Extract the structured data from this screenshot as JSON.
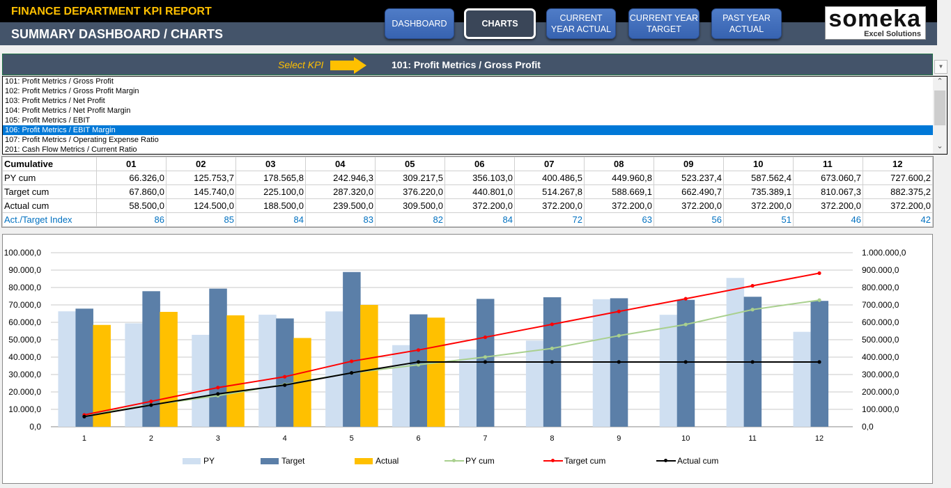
{
  "header": {
    "app_title": "FINANCE DEPARTMENT KPI REPORT",
    "page_title": "SUMMARY DASHBOARD / CHARTS",
    "nav": [
      {
        "label": "DASHBOARD",
        "active": false
      },
      {
        "label": "CHARTS",
        "active": true
      },
      {
        "label": "CURRENT YEAR ACTUAL",
        "active": false
      },
      {
        "label": "CURRENT YEAR TARGET",
        "active": false
      },
      {
        "label": "PAST YEAR ACTUAL",
        "active": false
      }
    ],
    "logo": {
      "brand": "someka",
      "sub": "Excel Solutions"
    }
  },
  "kpi_selector": {
    "label": "Select KPI",
    "value": "101: Profit Metrics / Gross Profit",
    "options": [
      "101: Profit Metrics / Gross Profit",
      "102: Profit Metrics / Gross Profit Margin",
      "103: Profit Metrics / Net Profit",
      "104: Profit Metrics / Net Profit Margin",
      "105: Profit Metrics / EBIT",
      "106: Profit Metrics / EBIT Margin",
      "107: Profit Metrics / Operating Expense Ratio",
      "201: Cash Flow Metrics / Current Ratio"
    ],
    "highlighted_index": 5
  },
  "table": {
    "header": "Cumulative",
    "months": [
      "01",
      "02",
      "03",
      "04",
      "05",
      "06",
      "07",
      "08",
      "09",
      "10",
      "11",
      "12"
    ],
    "rows": [
      {
        "label": "PY cum",
        "values": [
          "66.326,0",
          "125.753,7",
          "178.565,8",
          "242.946,3",
          "309.217,5",
          "356.103,0",
          "400.486,5",
          "449.960,8",
          "523.237,4",
          "587.562,4",
          "673.060,7",
          "727.600,2"
        ]
      },
      {
        "label": "Target cum",
        "values": [
          "67.860,0",
          "145.740,0",
          "225.100,0",
          "287.320,0",
          "376.220,0",
          "440.801,0",
          "514.267,8",
          "588.669,1",
          "662.490,7",
          "735.389,1",
          "810.067,3",
          "882.375,2"
        ]
      },
      {
        "label": "Actual cum",
        "values": [
          "58.500,0",
          "124.500,0",
          "188.500,0",
          "239.500,0",
          "309.500,0",
          "372.200,0",
          "372.200,0",
          "372.200,0",
          "372.200,0",
          "372.200,0",
          "372.200,0",
          "372.200,0"
        ]
      },
      {
        "label": "Act./Target Index",
        "values": [
          "86",
          "85",
          "84",
          "83",
          "82",
          "84",
          "72",
          "63",
          "56",
          "51",
          "46",
          "42"
        ]
      }
    ]
  },
  "chart_data": {
    "type": "bar",
    "categories": [
      "1",
      "2",
      "3",
      "4",
      "5",
      "6",
      "7",
      "8",
      "9",
      "10",
      "11",
      "12"
    ],
    "series": [
      {
        "name": "PY",
        "kind": "bar",
        "axis": "left",
        "color": "#cfdff1",
        "values": [
          66326.0,
          59427.7,
          52812.1,
          64380.5,
          66271.2,
          46885.5,
          44383.5,
          49474.3,
          73276.6,
          64325.0,
          85498.3,
          54539.5
        ]
      },
      {
        "name": "Target",
        "kind": "bar",
        "axis": "left",
        "color": "#5b7fa8",
        "values": [
          67860.0,
          77880.0,
          79360.0,
          62220.0,
          88900.0,
          64581.0,
          73466.8,
          74401.3,
          73821.6,
          72898.4,
          74678.2,
          72307.9
        ]
      },
      {
        "name": "Actual",
        "kind": "bar",
        "axis": "left",
        "color": "#ffc000",
        "values": [
          58500,
          66000,
          64000,
          51000,
          70000,
          62700,
          0,
          0,
          0,
          0,
          0,
          0
        ]
      },
      {
        "name": "PY cum",
        "kind": "line",
        "axis": "right",
        "color": "#a9d08e",
        "values": [
          66326.0,
          125753.7,
          178565.8,
          242946.3,
          309217.5,
          356103.0,
          400486.5,
          449960.8,
          523237.4,
          587562.4,
          673060.7,
          727600.2
        ]
      },
      {
        "name": "Target cum",
        "kind": "line",
        "axis": "right",
        "color": "#ff0000",
        "values": [
          67860.0,
          145740.0,
          225100.0,
          287320.0,
          376220.0,
          440801.0,
          514267.8,
          588669.1,
          662490.7,
          735389.1,
          810067.3,
          882375.2
        ]
      },
      {
        "name": "Actual cum",
        "kind": "line",
        "axis": "right",
        "color": "#000000",
        "values": [
          58500,
          124500,
          188500,
          239500,
          309500,
          372200,
          372200,
          372200,
          372200,
          372200,
          372200,
          372200
        ]
      }
    ],
    "left_axis": {
      "ylim": [
        0,
        100000
      ],
      "ticks": [
        "0,0",
        "10.000,0",
        "20.000,0",
        "30.000,0",
        "40.000,0",
        "50.000,0",
        "60.000,0",
        "70.000,0",
        "80.000,0",
        "90.000,0",
        "100.000,0"
      ]
    },
    "right_axis": {
      "ylim": [
        0,
        1000000
      ],
      "ticks": [
        "0,0",
        "100.000,0",
        "200.000,0",
        "300.000,0",
        "400.000,0",
        "500.000,0",
        "600.000,0",
        "700.000,0",
        "800.000,0",
        "900.000,0",
        "1.000.000,0"
      ]
    },
    "grid": true,
    "legend": "bottom",
    "title": ""
  }
}
